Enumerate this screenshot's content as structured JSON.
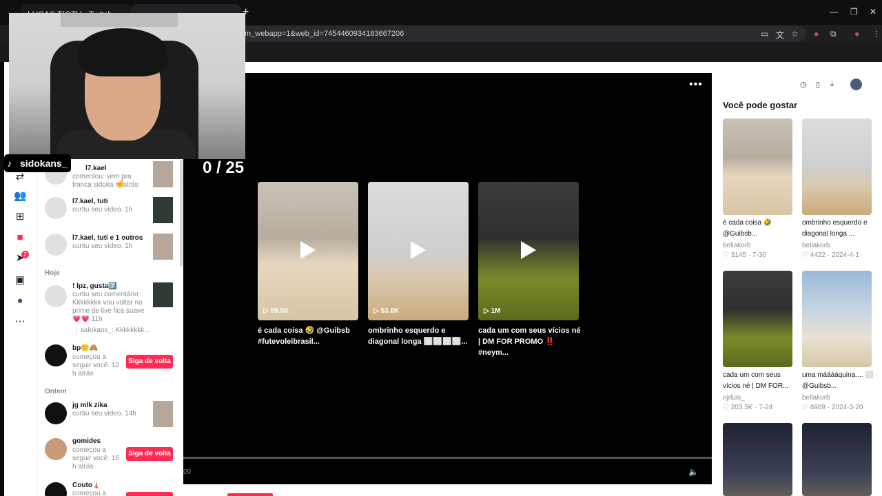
{
  "browser": {
    "tab1_title": "LUCAS TIOTV - Twitch",
    "url": "m_webapp=1&web_id=7454460934183667206"
  },
  "stream": {
    "handle": "sidokans_"
  },
  "player": {
    "counter": "0 / 25",
    "time": "09",
    "related": [
      {
        "views": "59.5K",
        "title": "é cada coisa 🤣 @Guibsb #futevoleibrasil..."
      },
      {
        "views": "53.6K",
        "title": "ombrinho esquerdo e diagonal longa ⬜⬜⬜⬜..."
      },
      {
        "views": "1M",
        "title": "cada um com seus vícios né | DM FOR PROMO ‼️ #neym..."
      }
    ]
  },
  "notifications": {
    "sections": {
      "today": "Hoje",
      "yesterday": "Ontem"
    },
    "items": [
      {
        "name": "l7.kael",
        "text": "comentou: vem pra franca sidoka",
        "time": "m atrás"
      },
      {
        "name": "l7.kael, tuti",
        "text": "curtiu seu vídeo. 1h"
      },
      {
        "name": "l7.kael, tuti e 1 outros",
        "text": "curtiu seu vídeo. 1h"
      },
      {
        "name": "! lpz, gusta7️⃣",
        "text": "curtiu seu comentário: Kkkkkkkk vou voltar no prime de live fica suave 💗💗 11h",
        "reply": "sidokans_: Kkkkkkkk..."
      },
      {
        "name": "bp😕🙈",
        "text": "começou a seguir você. 12 h atrás",
        "button": "Siga de volta"
      },
      {
        "name": "jg mlk zika",
        "text": "curtiu seu vídeo. 14h"
      },
      {
        "name": "gomides",
        "text": "começou a seguir você. 16 h atrás",
        "button": "Siga de volta"
      },
      {
        "name": "Couto🗼",
        "text": "começou a"
      }
    ]
  },
  "suggestions": {
    "heading": "Você pode gostar",
    "cards": [
      {
        "title": "é cada coisa 🤣 @Guibsb...",
        "author": "bellakorb",
        "likes": "3145",
        "date": "7-30"
      },
      {
        "title": "ombrinho esquerdo e diagonal longa ...",
        "author": "bellakorb",
        "likes": "4422",
        "date": "2024-4-1"
      },
      {
        "title": "cada um com seus vícios né | DM FOR...",
        "author": "njrluis_",
        "likes": "203.5K",
        "date": "7-24"
      },
      {
        "title": "uma mááááquina.... ⬜ @Guibsb...",
        "author": "bellakorb",
        "likes": "8989",
        "date": "2024-3-20"
      }
    ]
  }
}
